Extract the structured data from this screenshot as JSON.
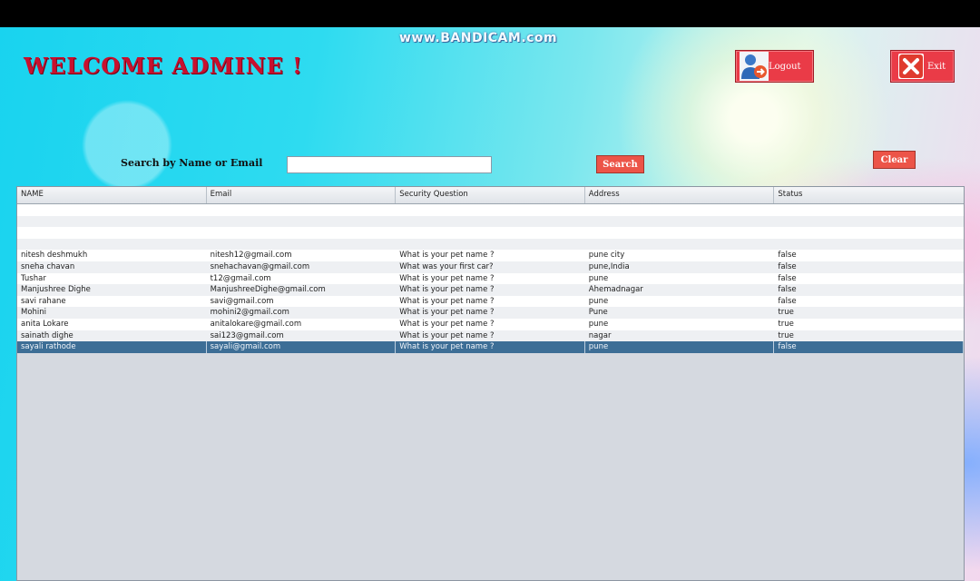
{
  "watermark": "www.BANDICAM.com",
  "header": {
    "title": "WELCOME ADMINE !",
    "logout_label": "Logout",
    "exit_label": "Exit"
  },
  "search": {
    "label": "Search by Name or Email",
    "value": "",
    "search_label": "Search",
    "clear_label": "Clear"
  },
  "table": {
    "columns": [
      "NAME",
      "Email",
      "Security Question",
      "Address",
      "Status"
    ],
    "rows": [
      [
        "",
        "",
        "",
        "",
        ""
      ],
      [
        "",
        "",
        "",
        "",
        ""
      ],
      [
        "",
        "",
        "",
        "",
        ""
      ],
      [
        "",
        "",
        "",
        "",
        ""
      ],
      [
        "nitesh deshmukh",
        "nitesh12@gmail.com",
        "What is your pet name ?",
        "pune city",
        "false"
      ],
      [
        "sneha chavan",
        "snehachavan@gmail.com",
        "What was your first car?",
        "pune,India",
        "false"
      ],
      [
        "Tushar",
        "t12@gmail.com",
        "What is your pet name ?",
        "pune",
        "false"
      ],
      [
        "Manjushree Dighe",
        "ManjushreeDighe@gmail.com",
        "What is your pet name ?",
        "Ahemadnagar",
        "false"
      ],
      [
        "savi rahane",
        "savi@gmail.com",
        "What is your pet name ?",
        "pune",
        "false"
      ],
      [
        "Mohini",
        "mohini2@gmail.com",
        "What is your pet name ?",
        "Pune",
        "true"
      ],
      [
        "anita Lokare",
        "anitalokare@gmail.com",
        "What is your pet name ?",
        "pune",
        "true"
      ],
      [
        "sainath dighe",
        "sai123@gmail.com",
        "What is your pet name ?",
        "nagar",
        "true"
      ],
      [
        "sayali rathode",
        "sayali@gmail.com",
        "What is your pet name ?",
        "pune",
        "false"
      ]
    ],
    "selected_row": 12
  },
  "colors": {
    "title": "#c8102e",
    "button": "#ea3b47",
    "selected_row": "#3d6e96"
  }
}
